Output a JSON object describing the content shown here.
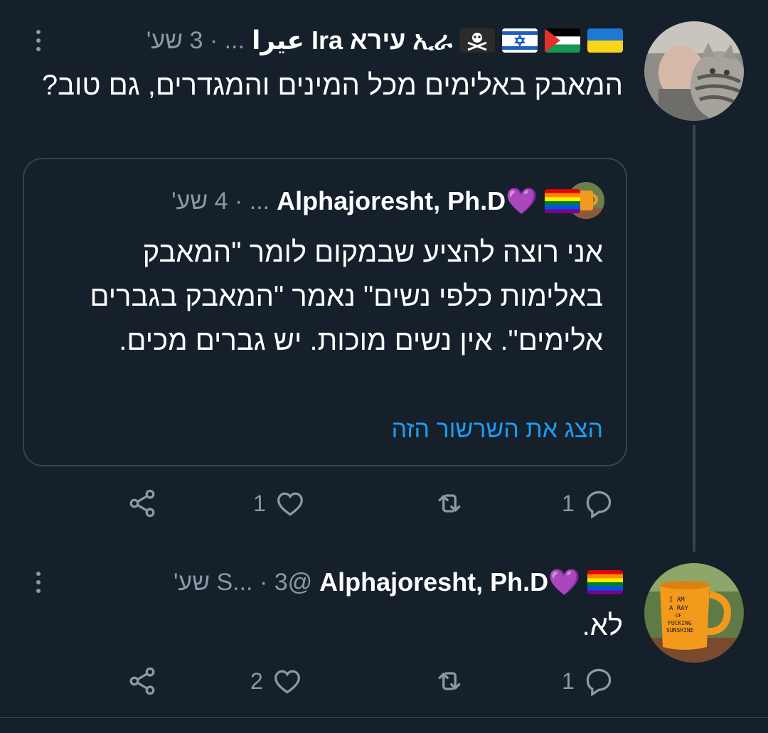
{
  "tweet1": {
    "author_name": "عيرا Ira עירא ኢራ",
    "meta": "... · 3 שע'",
    "text": "המאבק באלימים מכל המינים והמגדרים, גם טוב?",
    "quote": {
      "author_name": "Alphajoresht, Ph.D💜",
      "meta": "... · 4 שע'",
      "text": "אני רוצה להציע שבמקום לומר \"המאבק באלימות כלפי נשים\" נאמר \"המאבק בגברים אלימים\". אין נשים מוכות. יש גברים מכים.",
      "show_thread": "הצג את השרשור הזה",
      "avatar_icon": "mug-photo-icon"
    },
    "actions": {
      "reply_count": "1",
      "retweet_count": "",
      "like_count": "1"
    },
    "flags": [
      "ukraine-flag-icon",
      "palestine-flag-icon",
      "israel-flag-icon",
      "pirate-flag-icon"
    ]
  },
  "tweet2": {
    "author_name": "Alphajoresht, Ph.D💜",
    "meta": "@S... · 3 שע'",
    "text": "לא.",
    "mug_text": "I AM A RAY OF FUCKING SUNSHINE",
    "actions": {
      "reply_count": "1",
      "retweet_count": "",
      "like_count": "2"
    }
  },
  "colors": {
    "background": "#15202b",
    "secondary": "#8b98a5",
    "link": "#1d9bf0",
    "border": "#38444d"
  }
}
